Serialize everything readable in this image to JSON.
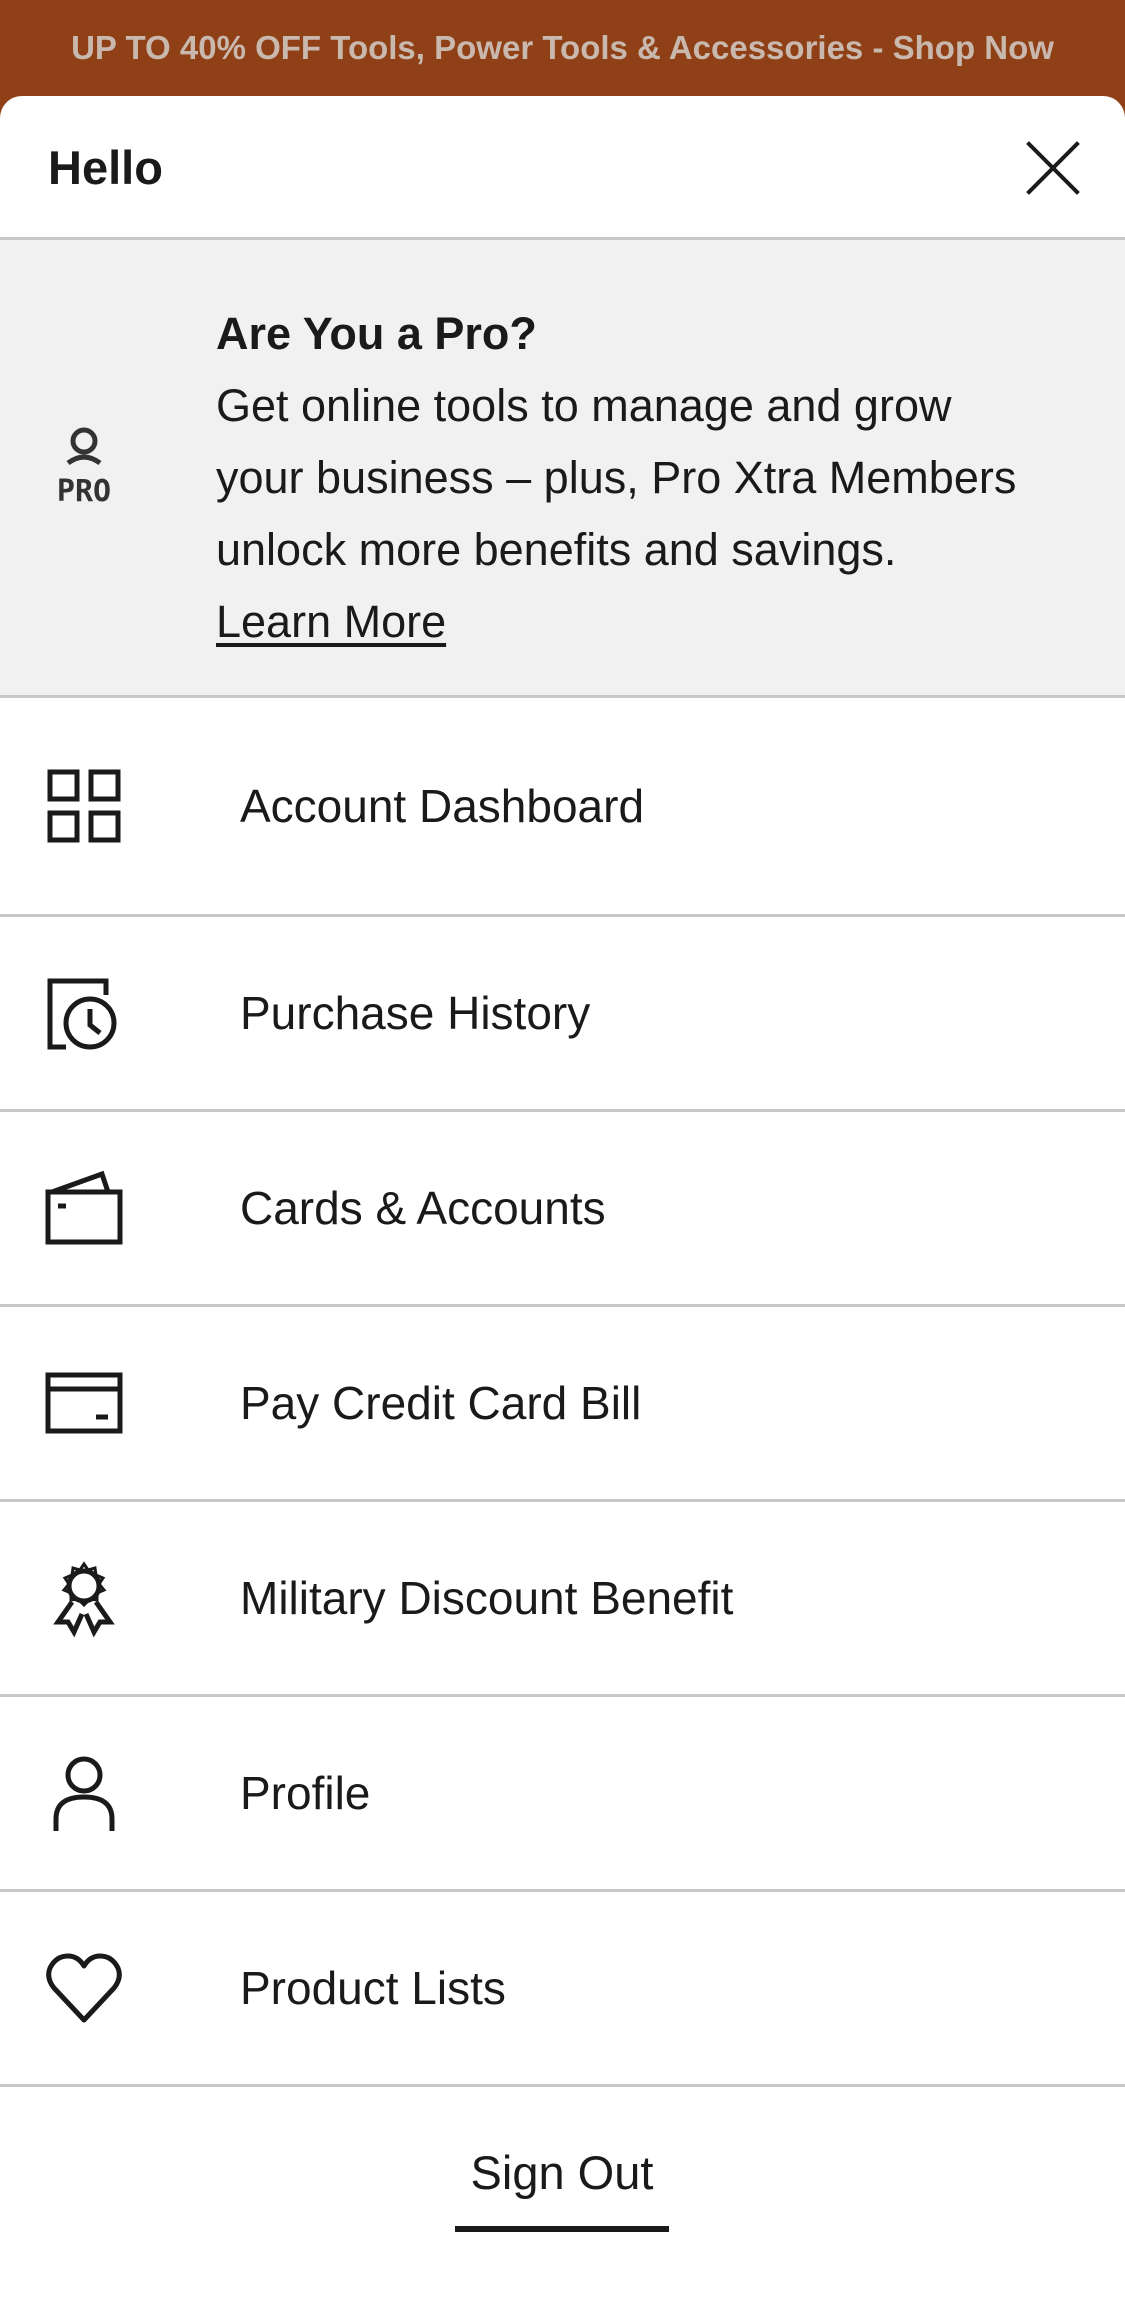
{
  "promo_banner": {
    "text": "UP TO 40% OFF Tools, Power Tools & Accessories - Shop Now"
  },
  "drawer": {
    "title": "Hello",
    "close_icon": "close-icon"
  },
  "pro": {
    "icon": "pro-icon",
    "title": "Are You a Pro?",
    "lines": [
      "Get online tools to manage and grow",
      "your business – plus, Pro Xtra Members",
      "unlock more benefits and savings."
    ],
    "link_label": "Learn More",
    "icon_text": "PRO"
  },
  "menu": {
    "items": [
      {
        "label": "Account Dashboard",
        "icon": "dashboard-grid-icon"
      },
      {
        "label": "Purchase History",
        "icon": "receipt-clock-icon"
      },
      {
        "label": "Cards & Accounts",
        "icon": "wallet-icon"
      },
      {
        "label": "Pay Credit Card Bill",
        "icon": "credit-card-icon"
      },
      {
        "label": "Military Discount Benefit",
        "icon": "award-ribbon-icon"
      },
      {
        "label": "Profile",
        "icon": "person-icon"
      },
      {
        "label": "Product Lists",
        "icon": "heart-icon"
      }
    ]
  },
  "sign_out": {
    "label": "Sign Out"
  },
  "colors": {
    "banner_bg": "#8f4016",
    "banner_text": "#c9b8ad",
    "pro_bg": "#f1f1f1",
    "divider": "#c8c8c8",
    "text": "#1a1a1a"
  }
}
